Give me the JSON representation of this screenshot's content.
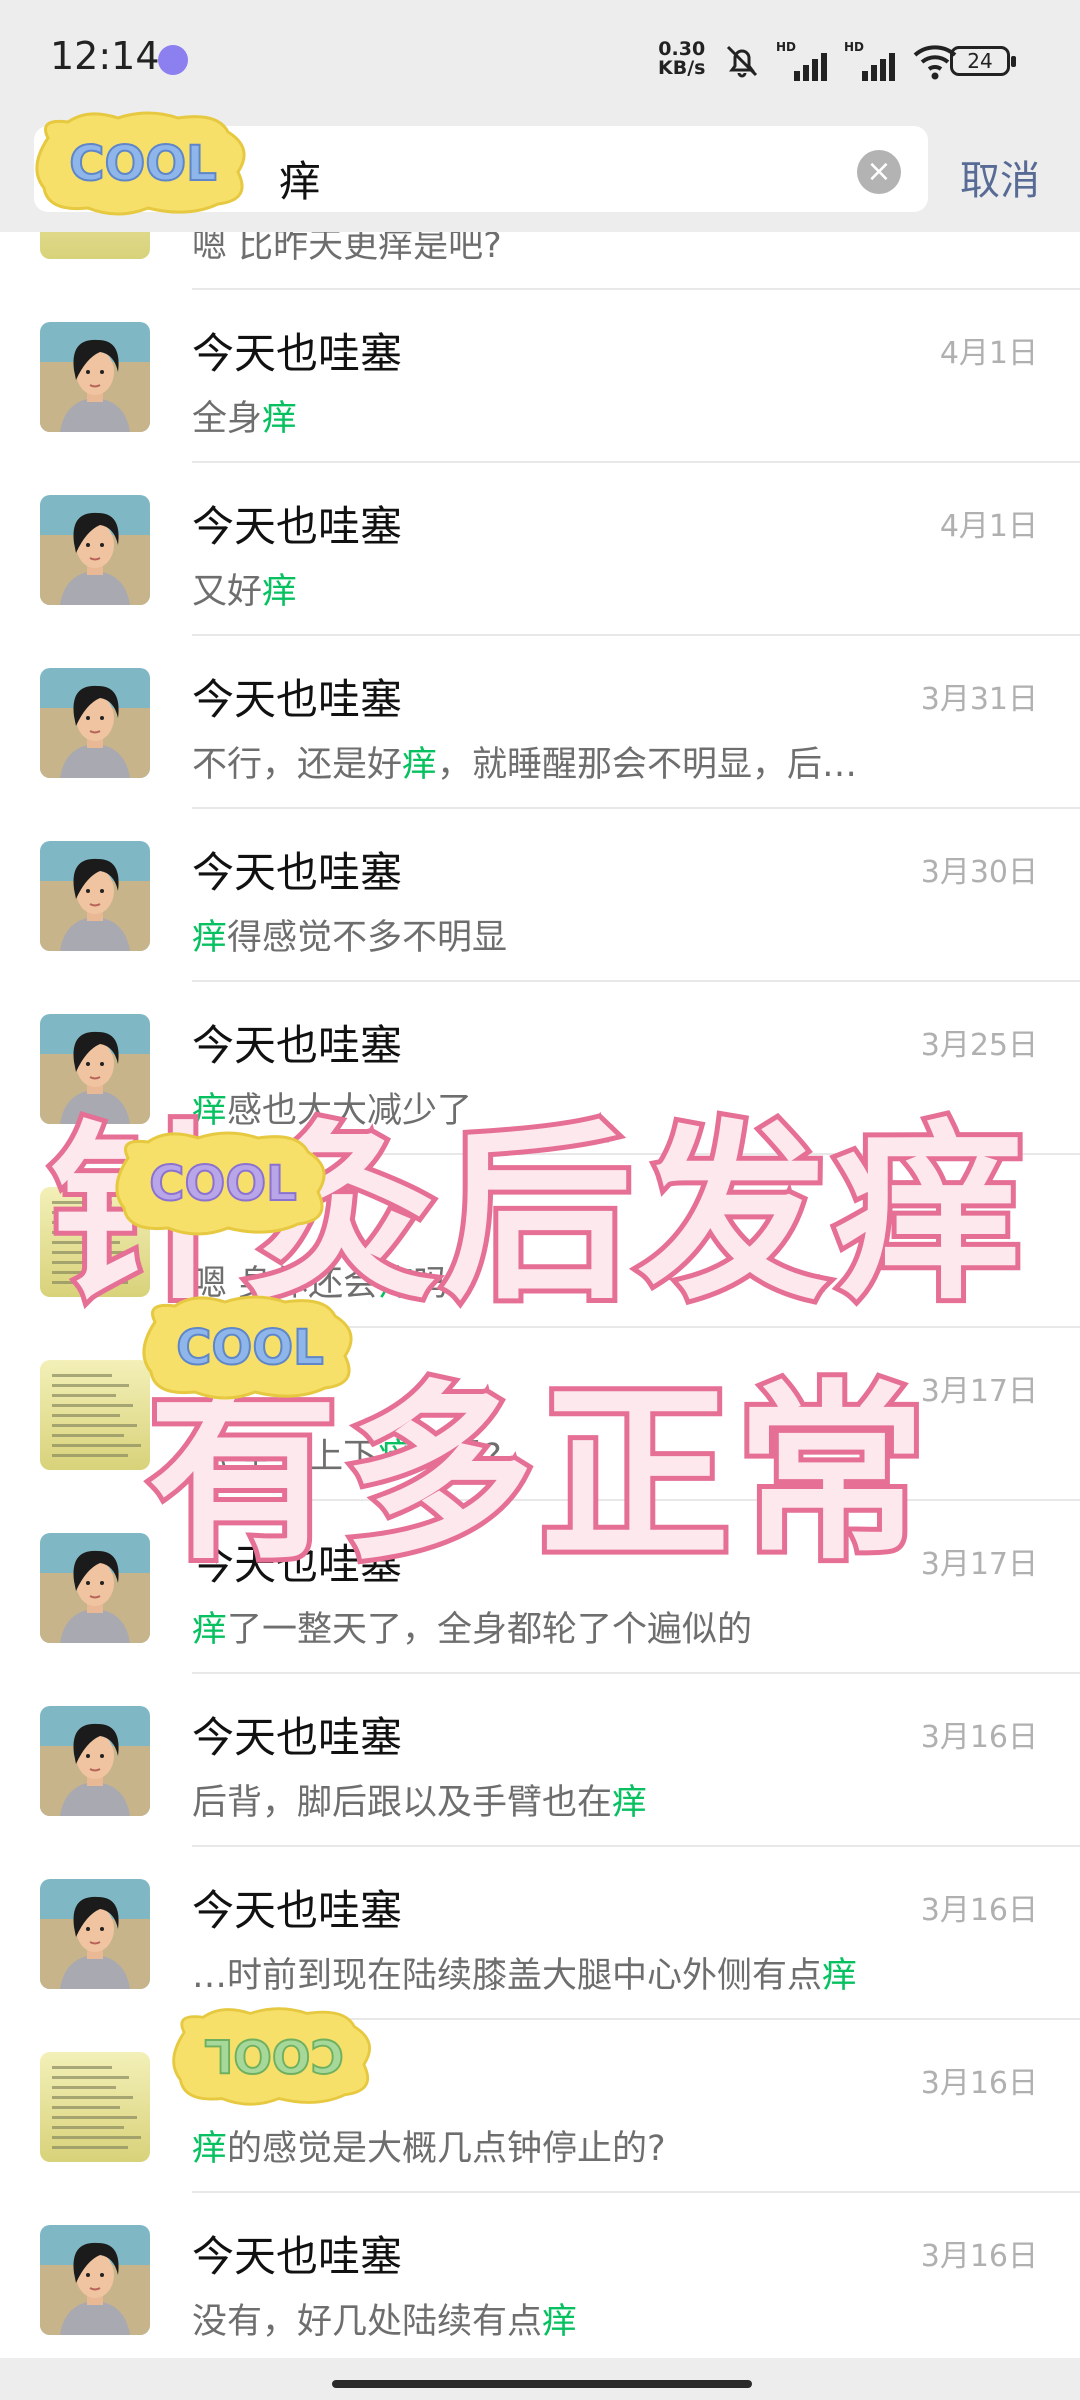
{
  "status_bar": {
    "time": "12:14",
    "net_speed_value": "0.30",
    "net_speed_unit": "KB/s",
    "battery": "24",
    "hd": "HD"
  },
  "search": {
    "query": "痒",
    "cancel_label": "取消"
  },
  "partial_row": {
    "snippet": "嗯 比昨天更痒是吧?"
  },
  "results": [
    {
      "title": "今天也哇塞",
      "date": "4月1日",
      "pre": "全身",
      "hl": "痒",
      "post": "",
      "avatar": "person"
    },
    {
      "title": "今天也哇塞",
      "date": "4月1日",
      "pre": "又好",
      "hl": "痒",
      "post": "",
      "avatar": "person"
    },
    {
      "title": "今天也哇塞",
      "date": "3月31日",
      "pre": "不行，还是好",
      "hl": "痒",
      "post": "，就睡醒那会不明显，后…",
      "avatar": "person"
    },
    {
      "title": "今天也哇塞",
      "date": "3月30日",
      "pre": "",
      "hl": "痒",
      "post": "得感觉不多不明显",
      "avatar": "person"
    },
    {
      "title": "今天也哇塞",
      "date": "3月25日",
      "pre": "",
      "hl": "痒",
      "post": "感也大大减少了",
      "avatar": "person"
    },
    {
      "title": "",
      "date": "",
      "pre": "嗯 身体还会",
      "hl": "痒",
      "post": "吗?",
      "avatar": "doc"
    },
    {
      "title": "",
      "date": "3月17日",
      "pre": "你 全身上下",
      "hl": "痒",
      "post": "是吗?",
      "avatar": "doc"
    },
    {
      "title": "今天也哇塞",
      "date": "3月17日",
      "pre": "",
      "hl": "痒",
      "post": "了一整天了，全身都轮了个遍似的",
      "avatar": "person"
    },
    {
      "title": "今天也哇塞",
      "date": "3月16日",
      "pre": "后背，脚后跟以及手臂也在",
      "hl": "痒",
      "post": "",
      "avatar": "person"
    },
    {
      "title": "今天也哇塞",
      "date": "3月16日",
      "pre": "…时前到现在陆续膝盖大腿中心外侧有点",
      "hl": "痒",
      "post": "",
      "avatar": "person"
    },
    {
      "title": "",
      "date": "3月16日",
      "pre": "",
      "hl": "痒",
      "post": "的感觉是大概几点钟停止的?",
      "avatar": "doc"
    },
    {
      "title": "今天也哇塞",
      "date": "3月16日",
      "pre": "没有，好几处陆续有点",
      "hl": "痒",
      "post": "",
      "avatar": "person"
    }
  ],
  "overlay": {
    "line1": "针灸后发痒",
    "line2": "有多正常"
  },
  "stickers": {
    "cool_text": "COOL"
  },
  "colors": {
    "highlight": "#07c160",
    "cancel": "#576b95",
    "overlay_fill": "#fde8ee",
    "overlay_stroke": "#e56f95"
  }
}
